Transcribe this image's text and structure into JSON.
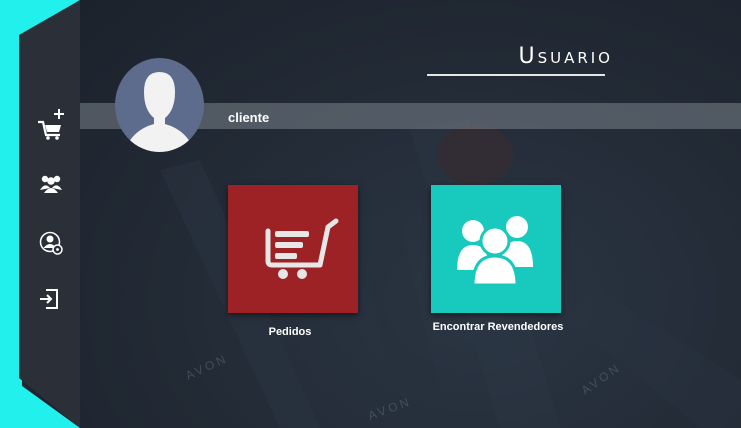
{
  "header": {
    "title": "Usuario"
  },
  "user": {
    "name": "cliente"
  },
  "tiles": [
    {
      "label": "Pedidos",
      "color": "#9c2226",
      "icon": "shopping-cart-icon"
    },
    {
      "label": "Encontrar Revendedores",
      "color": "#18c9bd",
      "icon": "people-group-icon"
    }
  ],
  "sidebar": {
    "items": [
      {
        "icon": "add-to-cart-icon"
      },
      {
        "icon": "users-group-icon"
      },
      {
        "icon": "user-settings-icon"
      },
      {
        "icon": "logout-icon"
      }
    ]
  },
  "background": {
    "watermark": "AVON"
  },
  "colors": {
    "accent_cyan": "#22f0ec",
    "sidebar": "#2a2f38",
    "pedidos": "#9c2226",
    "revendedores": "#18c9bd"
  }
}
